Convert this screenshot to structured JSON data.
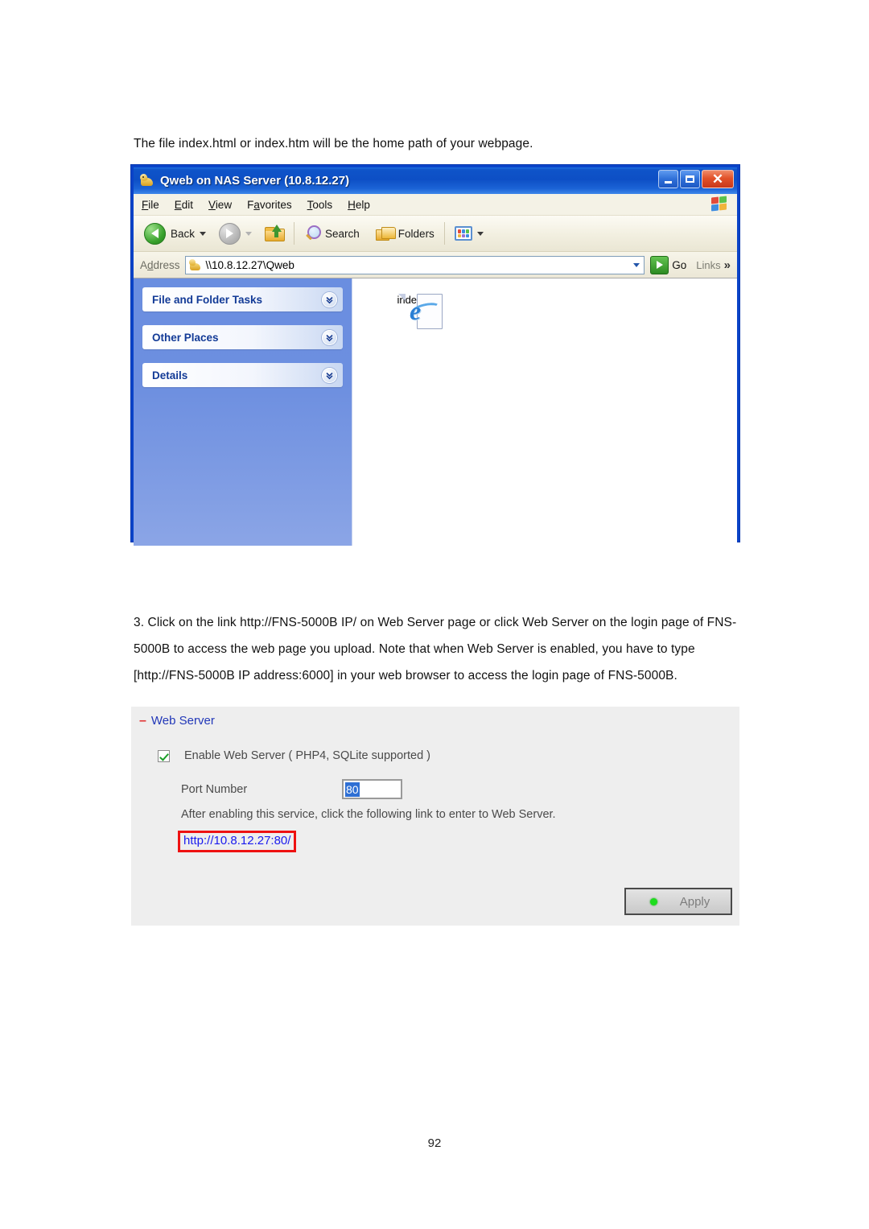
{
  "document": {
    "intro_line": "The file index.html or index.htm will be the home path of your webpage.",
    "step_3": "3. Click on the link http://FNS-5000B IP/ on Web Server page or click Web Server on the login page of FNS-5000B to access the web page you upload.  Note that when Web Server is enabled, you have to type [http://FNS-5000B IP address:6000] in your web browser to access the login page of FNS-5000B.",
    "page_number": "92"
  },
  "explorer": {
    "title": "Qweb on NAS Server (10.8.12.27)",
    "window_buttons": {
      "minimize": "Minimize",
      "maximize": "Maximize",
      "close": "✕"
    },
    "menu": [
      {
        "label": "File",
        "accel": "F"
      },
      {
        "label": "Edit",
        "accel": "E"
      },
      {
        "label": "View",
        "accel": "V"
      },
      {
        "label": "Favorites",
        "accel": "a"
      },
      {
        "label": "Tools",
        "accel": "T"
      },
      {
        "label": "Help",
        "accel": "H"
      }
    ],
    "toolbar": {
      "back_label": "Back",
      "search_label": "Search",
      "folders_label": "Folders",
      "icons": [
        "back-arrow-icon",
        "forward-arrow-icon",
        "up-folder-icon",
        "search-magnifier-icon",
        "folders-icon",
        "views-icon"
      ]
    },
    "address": {
      "label": "Address",
      "value": "\\\\10.8.12.27\\Qweb",
      "go_label": "Go",
      "links_label": "Links",
      "overflow_chevron": "»"
    },
    "sidebar": {
      "panels": [
        {
          "title": "File and Folder Tasks"
        },
        {
          "title": "Other Places"
        },
        {
          "title": "Details"
        }
      ]
    },
    "content": {
      "files": [
        {
          "name": "index",
          "icon": "internet-explorer-document-icon"
        }
      ]
    }
  },
  "webserver": {
    "section_title": "Web Server",
    "collapse_glyph": "–",
    "enable_label": "Enable Web Server  ( PHP4, SQLite supported )",
    "enable_checked": true,
    "port_label": "Port Number",
    "port_value": "80",
    "note": "After enabling this service, click the following link to enter to Web Server.",
    "link": "http://10.8.12.27:80/",
    "apply_label": "Apply",
    "colors": {
      "panel_background": "#eeeeee",
      "section_title": "#2137b8",
      "collapse_glyph": "#e03030",
      "link": "#1a1aee",
      "highlight_box_border": "#ee1111",
      "apply_status_dot": "#1ddd1d",
      "checkbox_check": "#1a9e28",
      "port_selection": "#2e6fd4"
    }
  }
}
